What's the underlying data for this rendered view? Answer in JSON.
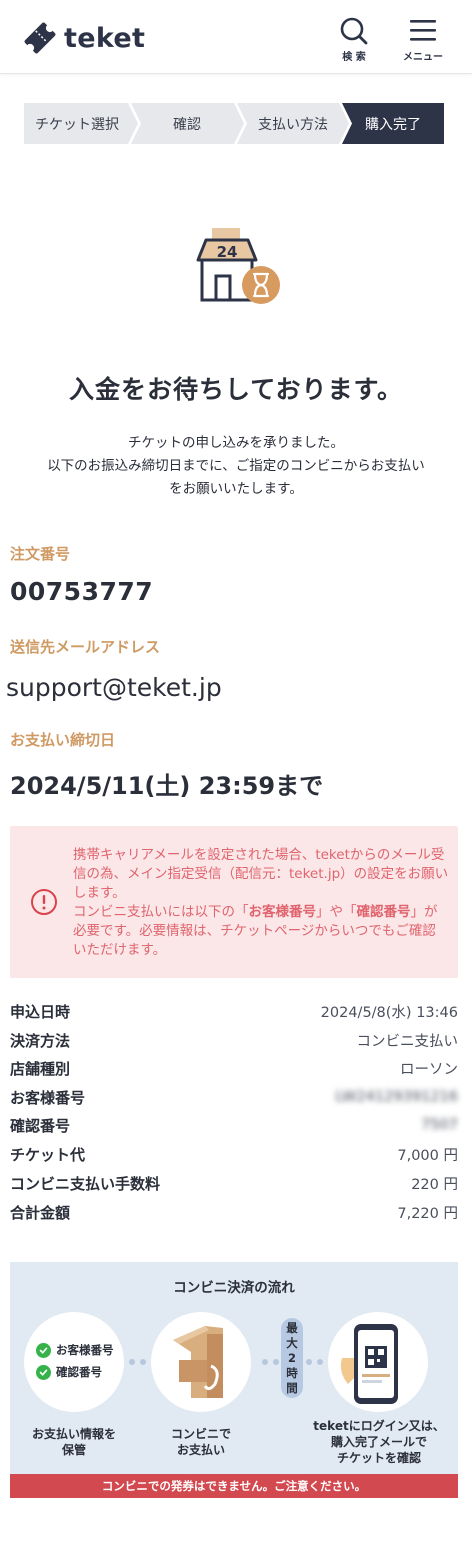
{
  "header": {
    "logo_text": "teket",
    "search_label": "検 索",
    "menu_label": "メニュー"
  },
  "stepper": {
    "steps": [
      "チケット選択",
      "確認",
      "支払い方法",
      "購入完了"
    ],
    "active_index": 3
  },
  "illustration": {
    "badge_text": "24",
    "icon_name": "convenience-store-hourglass-icon"
  },
  "main": {
    "title": "入金をお待ちしております。",
    "desc_lines": [
      "チケットの申し込みを承りました。",
      "以下のお振込み締切日までに、ご指定のコンビニからお支払い",
      "をお願いいたします。"
    ]
  },
  "fields": {
    "order_label": "注文番号",
    "order_value": "00753777",
    "email_label": "送信先メールアドレス",
    "email_value": "support@teket.jp",
    "deadline_label": "お支払い締切日",
    "deadline_value": "2024/5/11(土) 23:59まで"
  },
  "notice": {
    "icon_name": "alert-circle-icon",
    "line1": "携帯キャリアメールを設定された場合、teketからのメール受信の為、メイン指定受信（配信元：teket.jp）の設定をお願いします。",
    "line2_pre": "コンビニ支払いには以下の「",
    "customer_no": "お客様番号",
    "line2_mid": "」や「",
    "confirm_no": "確認番号",
    "line2_post": "」が必要です。必要情報は、チケットページからいつでもご確認いただけます。"
  },
  "summary": [
    {
      "label": "申込日時",
      "value": "2024/5/8(水) 13:46",
      "blurred": false
    },
    {
      "label": "決済方法",
      "value": "コンビニ支払い",
      "blurred": false
    },
    {
      "label": "店舗種別",
      "value": "ローソン",
      "blurred": false
    },
    {
      "label": "お客様番号",
      "value": "LW24129391216",
      "blurred": true
    },
    {
      "label": "確認番号",
      "value": "7507",
      "blurred": true
    },
    {
      "label": "チケット代",
      "value": "7,000 円",
      "blurred": false
    },
    {
      "label": "コンビニ支払い手数料",
      "value": "220 円",
      "blurred": false
    },
    {
      "label": "合計金額",
      "value": "7,220 円",
      "blurred": false
    }
  ],
  "flow": {
    "title": "コンビニ決済の流れ",
    "step1_checks": [
      "お客様番号",
      "確認番号"
    ],
    "step1_caption": [
      "お支払い情報を",
      "保管"
    ],
    "step2_caption": [
      "コンビニで",
      "お支払い"
    ],
    "pill_chars": [
      "最",
      "大",
      "2",
      "時",
      "間"
    ],
    "step3_caption": [
      "teketにログイン又は、",
      "購入完了メールで",
      "チケットを確認"
    ],
    "warning": "コンビニでの発券はできません。ご注意ください。"
  },
  "colors": {
    "accent": "#cf9a63",
    "navy": "#2e3448",
    "notice_bg": "#fbe7e8",
    "notice_text": "#e0646e",
    "flow_bg": "#e1e9f3",
    "warn": "#d24a50"
  }
}
